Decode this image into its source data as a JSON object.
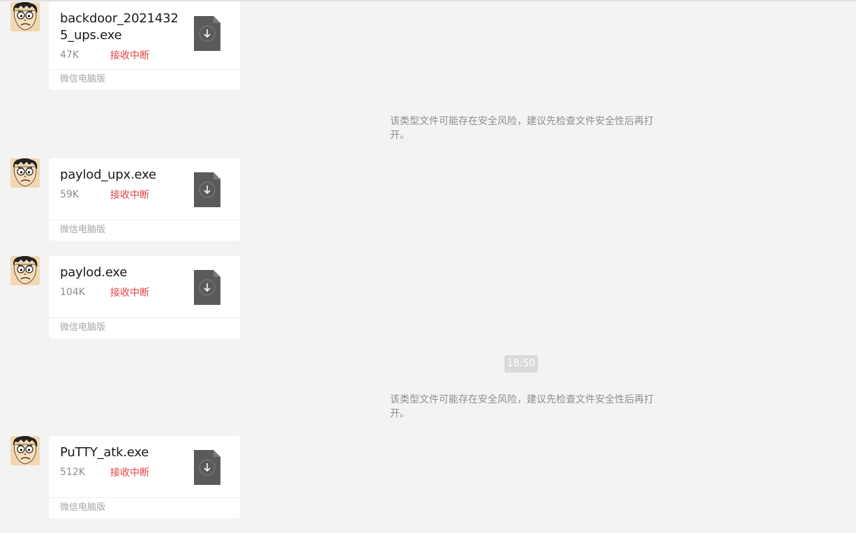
{
  "messages": [
    {
      "file_name": "backdoor_20214325_ups.exe",
      "file_size": "47K",
      "status": "接收中断",
      "source": "微信电脑版",
      "icon": "file-download-icon"
    },
    {
      "file_name": "paylod_upx.exe",
      "file_size": "59K",
      "status": "接收中断",
      "source": "微信电脑版",
      "icon": "file-download-icon"
    },
    {
      "file_name": "paylod.exe",
      "file_size": "104K",
      "status": "接收中断",
      "source": "微信电脑版",
      "icon": "file-download-icon"
    },
    {
      "file_name": "PuTTY_atk.exe",
      "file_size": "512K",
      "status": "接收中断",
      "source": "微信电脑版",
      "icon": "file-download-icon"
    }
  ],
  "notices": [
    {
      "text": "该类型文件可能存在安全风险，建议先检查文件安全性后再打开。"
    },
    {
      "text": "该类型文件可能存在安全风险，建议先检查文件安全性后再打开。"
    }
  ],
  "timestamp": "18:50",
  "colors": {
    "background": "#f3f3f3",
    "card": "#ffffff",
    "status_error": "#e64340",
    "muted_text": "#8d8d8d",
    "file_icon": "#5a5a5a",
    "time_pill": "#dadada"
  },
  "avatar": {
    "icon": "cartoon-face-avatar"
  }
}
